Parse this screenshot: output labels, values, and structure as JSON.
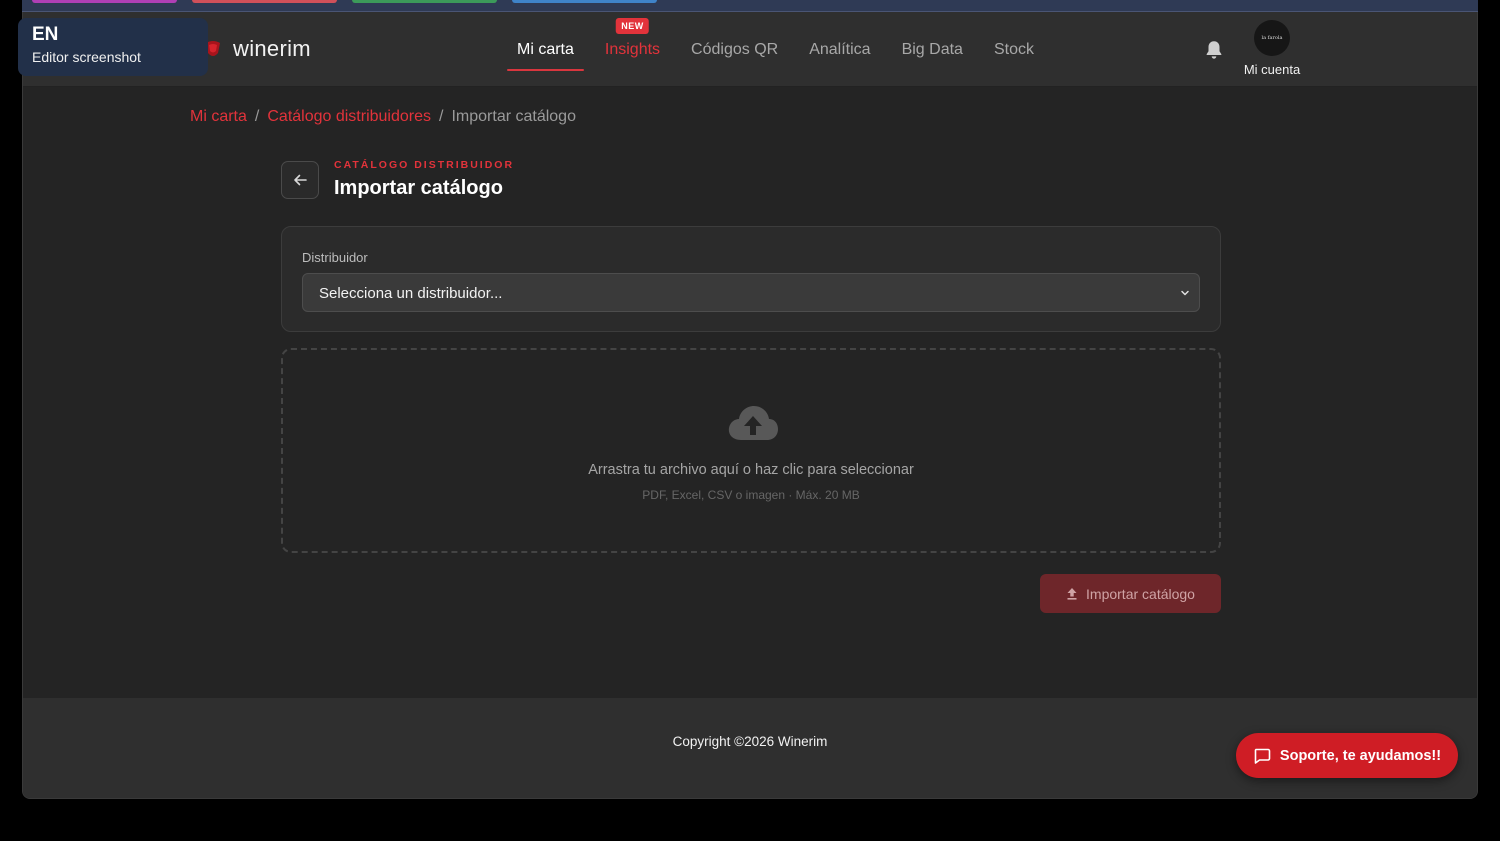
{
  "language_chip": {
    "code": "EN",
    "label": "Editor screenshot"
  },
  "brand": {
    "name": "winerim",
    "accent": "#e2333b"
  },
  "nav": {
    "items": [
      {
        "label": "Mi carta",
        "active": true
      },
      {
        "label": "Insights",
        "badge": "NEW"
      },
      {
        "label": "Códigos QR"
      },
      {
        "label": "Analítica"
      },
      {
        "label": "Big Data"
      },
      {
        "label": "Stock"
      }
    ]
  },
  "account": {
    "label": "Mi cuenta",
    "avatar_text": "la farola"
  },
  "breadcrumb": {
    "items": [
      "Mi carta",
      "Catálogo distribuidores",
      "Importar catálogo"
    ],
    "separator": "/"
  },
  "header": {
    "eyebrow": "CATÁLOGO DISTRIBUIDOR",
    "title": "Importar catálogo"
  },
  "form": {
    "distributor_label": "Distribuidor",
    "distributor_value": "Selecciona un distribuidor..."
  },
  "dropzone": {
    "main_text": "Arrastra tu archivo aquí o haz clic para seleccionar",
    "sub_text": "PDF, Excel, CSV o imagen · Máx. 20 MB"
  },
  "actions": {
    "import_label": "Importar catálogo"
  },
  "footer": {
    "copyright": "Copyright ©2026 Winerim"
  },
  "support": {
    "label": "Soporte, te ayudamos!!"
  }
}
